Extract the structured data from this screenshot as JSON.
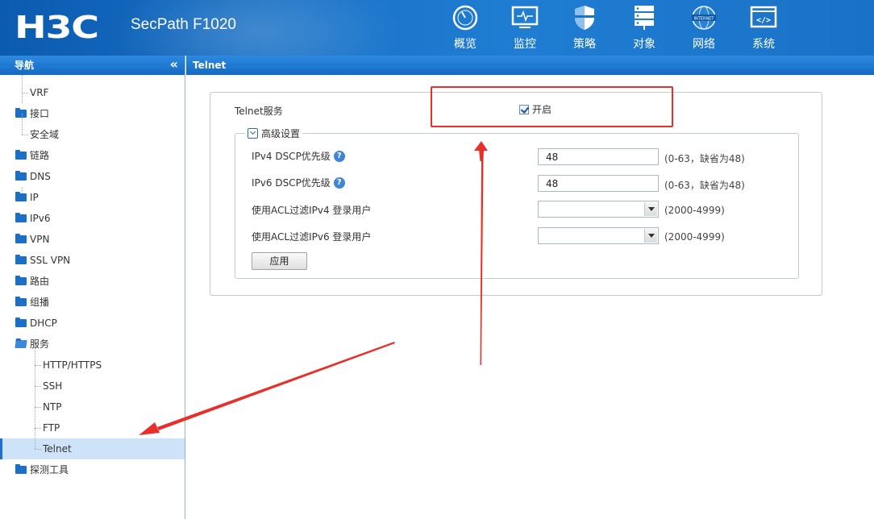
{
  "header": {
    "brand": "H3C",
    "product": "SecPath F1020",
    "nav": [
      {
        "label": "概览",
        "icon": "gauge-icon"
      },
      {
        "label": "监控",
        "icon": "monitor-icon"
      },
      {
        "label": "策略",
        "icon": "shield-icon"
      },
      {
        "label": "对象",
        "icon": "server-icon"
      },
      {
        "label": "网络",
        "icon": "globe-icon"
      },
      {
        "label": "系统",
        "icon": "code-window-icon"
      }
    ]
  },
  "sidebar": {
    "title": "导航",
    "collapse": "«",
    "items": [
      {
        "label": "VRF"
      },
      {
        "label": "接口"
      },
      {
        "label": "安全域"
      },
      {
        "label": "链路"
      },
      {
        "label": "DNS"
      },
      {
        "label": "IP"
      },
      {
        "label": "IPv6"
      },
      {
        "label": "VPN"
      },
      {
        "label": "SSL VPN"
      },
      {
        "label": "路由"
      },
      {
        "label": "组播"
      },
      {
        "label": "DHCP"
      },
      {
        "label": "服务"
      },
      {
        "label": "HTTP/HTTPS"
      },
      {
        "label": "SSH"
      },
      {
        "label": "NTP"
      },
      {
        "label": "FTP"
      },
      {
        "label": "Telnet"
      },
      {
        "label": "探测工具"
      }
    ]
  },
  "content": {
    "title": "Telnet",
    "service_label": "Telnet服务",
    "enable_label": "开启",
    "enabled": true,
    "advanced_legend": "高级设置",
    "ipv4_dscp_label": "IPv4 DSCP优先级",
    "ipv4_dscp_value": "48",
    "ipv4_dscp_hint": "(0-63，缺省为48)",
    "ipv6_dscp_label": "IPv6 DSCP优先级",
    "ipv6_dscp_value": "48",
    "ipv6_dscp_hint": "(0-63，缺省为48)",
    "acl_ipv4_label": "使用ACL过滤IPv4 登录用户",
    "acl_ipv4_hint": "(2000-4999)",
    "acl_ipv6_label": "使用ACL过滤IPv6 登录用户",
    "acl_ipv6_hint": "(2000-4999)",
    "apply_label": "应用",
    "help_glyph": "?"
  },
  "colors": {
    "header_blue": "#1a73c8",
    "annotation_red": "#e8302a",
    "selected_row": "#cfe3f8"
  }
}
